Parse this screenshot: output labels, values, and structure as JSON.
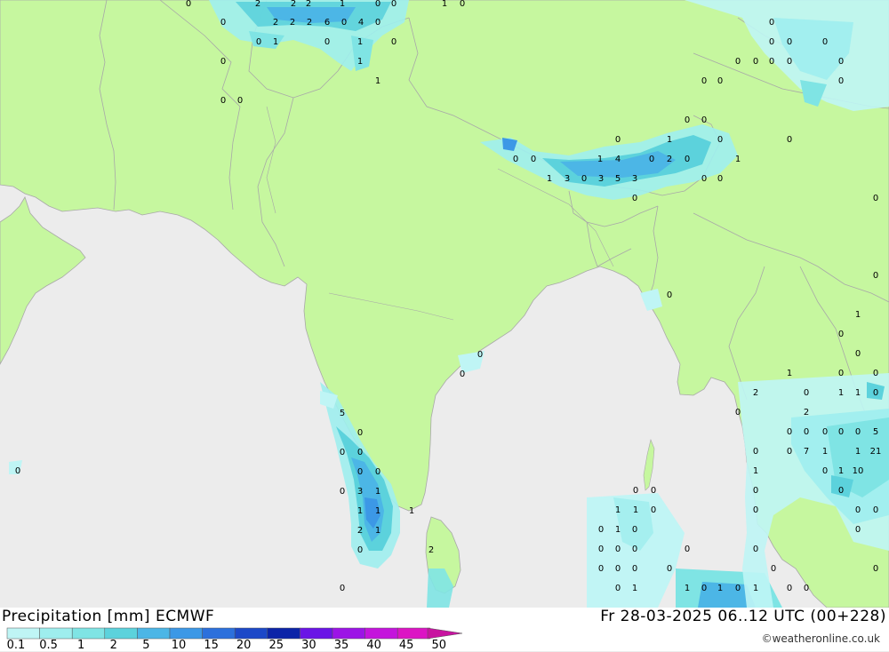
{
  "title_left": "Precipitation [mm] ECMWF",
  "title_right": "Fr 28-03-2025 06..12 UTC (00+228)",
  "credit": "©weatheronline.co.uk",
  "legend": {
    "colors": [
      "#bff5f5",
      "#9eeeee",
      "#7fe4e4",
      "#5cd2dc",
      "#4cb6e6",
      "#3c98e6",
      "#2c70dc",
      "#1c48c8",
      "#0c24a8",
      "#6a14e6",
      "#9c14e6",
      "#c414dc",
      "#dc14c4",
      "#c814a0"
    ],
    "ticks": [
      "0.1",
      "0.5",
      "1",
      "2",
      "5",
      "10",
      "15",
      "20",
      "25",
      "30",
      "35",
      "40",
      "45",
      "50"
    ]
  },
  "map_colors": {
    "sea": "#ececec",
    "land": "#c6f79f",
    "border": "#a8a8a8"
  },
  "values": [
    "0",
    "2",
    "2",
    "2",
    "1",
    "0",
    "0",
    "1",
    "0",
    "0",
    "2",
    "2",
    "2",
    "6",
    "0",
    "4",
    "0",
    "0",
    "1",
    "0",
    "1",
    "0",
    "0",
    "1",
    "1",
    "0",
    "0",
    "0",
    "0",
    "0",
    "0",
    "0",
    "0",
    "0",
    "0",
    "0",
    "0",
    "0",
    "0",
    "0",
    "0",
    "0",
    "1",
    "0",
    "0",
    "0",
    "1",
    "4",
    "0",
    "2",
    "0",
    "1",
    "1",
    "3",
    "0",
    "3",
    "5",
    "3",
    "0",
    "0",
    "0",
    "0",
    "0",
    "0",
    "0",
    "0",
    "0",
    "1",
    "0",
    "0",
    "1",
    "0",
    "0",
    "0",
    "5",
    "0",
    "0",
    "0",
    "0",
    "0",
    "0",
    "3",
    "1",
    "1",
    "1",
    "1",
    "1",
    "2",
    "0",
    "2",
    "1",
    "1",
    "2",
    "0",
    "0",
    "2",
    "0",
    "0",
    "0",
    "0",
    "0",
    "5",
    "0",
    "0",
    "7",
    "1",
    "1",
    "21",
    "0",
    "1",
    "10",
    "1",
    "0",
    "0",
    "0",
    "0",
    "0",
    "0",
    "0",
    "0",
    "0",
    "1",
    "1",
    "0",
    "0",
    "1",
    "0",
    "0",
    "0",
    "0",
    "0",
    "0",
    "0",
    "0",
    "0",
    "0",
    "0",
    "0",
    "0",
    "0",
    "1",
    "1",
    "0",
    "1",
    "0",
    "1",
    "0",
    "0",
    "0",
    "0",
    "0",
    "0"
  ]
}
